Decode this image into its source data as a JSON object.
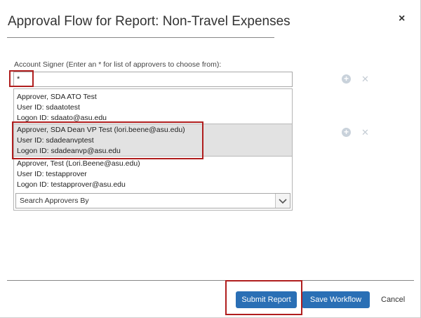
{
  "dialog": {
    "title": "Approval Flow for Report: Non-Travel Expenses",
    "close_glyph": "×"
  },
  "signer": {
    "label": "Account Signer (Enter an * for list of approvers to choose from):",
    "value": "*"
  },
  "approvers": [
    {
      "name": "Approver, SDA ATO Test",
      "user_id": "User ID: sdaatotest",
      "logon_id": "Logon ID: sdaato@asu.edu",
      "selected": false
    },
    {
      "name": "Approver, SDA Dean VP Test (lori.beene@asu.edu)",
      "user_id": "User ID: sdadeanvptest",
      "logon_id": "Logon ID: sdadeanvp@asu.edu",
      "selected": true
    },
    {
      "name": "Approver, Test (Lori.Beene@asu.edu)",
      "user_id": "User ID: testapprover",
      "logon_id": "Logon ID: testapprover@asu.edu",
      "selected": false
    }
  ],
  "search_by": {
    "label": "Search Approvers By"
  },
  "icons": {
    "add": "add-circle-icon",
    "remove": "remove-x-icon",
    "dropdown_arrow": "chevron-down-icon"
  },
  "footer": {
    "submit_label": "Submit Report",
    "save_label": "Save Workflow",
    "cancel_label": "Cancel"
  },
  "colors": {
    "primary_button": "#2a6fb5",
    "highlight_box": "#b01e1e",
    "selected_row": "#e2e2e2"
  }
}
